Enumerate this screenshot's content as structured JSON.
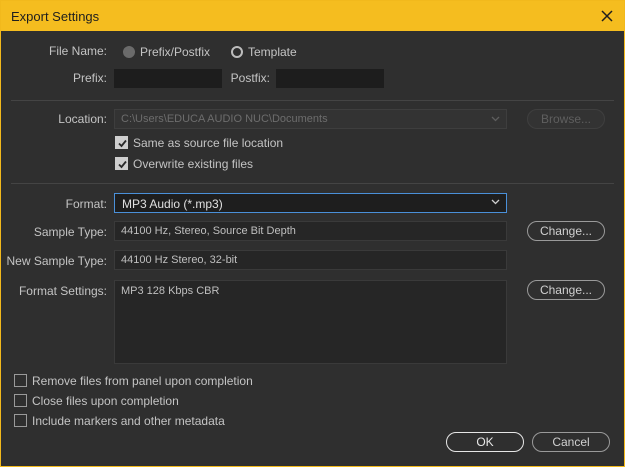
{
  "window": {
    "title": "Export Settings"
  },
  "file_name": {
    "label": "File Name:",
    "options": [
      "Prefix/Postfix",
      "Template"
    ],
    "selected": "Prefix/Postfix",
    "prefix_label": "Prefix:",
    "prefix_value": "",
    "postfix_label": "Postfix:",
    "postfix_value": ""
  },
  "location": {
    "label": "Location:",
    "value": "C:\\Users\\EDUCA AUDIO NUC\\Documents",
    "browse_label": "Browse...",
    "same_as_source_label": "Same as source file location",
    "same_as_source_checked": true,
    "overwrite_label": "Overwrite existing files",
    "overwrite_checked": true
  },
  "format": {
    "label": "Format:",
    "value": "MP3 Audio (*.mp3)",
    "sample_type_label": "Sample Type:",
    "sample_type_value": "44100 Hz, Stereo, Source Bit Depth",
    "new_sample_type_label": "New Sample Type:",
    "new_sample_type_value": "44100 Hz Stereo, 32-bit",
    "format_settings_label": "Format Settings:",
    "format_settings_value": "MP3 128 Kbps CBR",
    "change_label": "Change..."
  },
  "options": {
    "remove_files_label": "Remove files from panel upon completion",
    "remove_files_checked": false,
    "close_files_label": "Close files upon completion",
    "close_files_checked": false,
    "include_markers_label": "Include markers and other metadata",
    "include_markers_checked": false
  },
  "buttons": {
    "ok": "OK",
    "cancel": "Cancel"
  },
  "colors": {
    "titlebar": "#f5bd1f",
    "focus_border": "#4a90d9",
    "background": "#2f2f2f"
  }
}
